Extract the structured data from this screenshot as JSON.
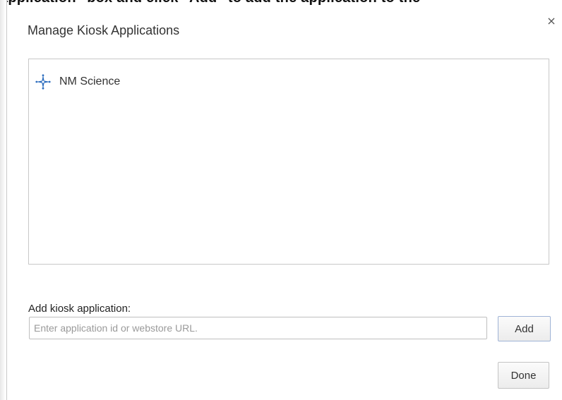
{
  "background": {
    "cut_text": "application\" box and click \"Add\" to add the application to the"
  },
  "dialog": {
    "title": "Manage Kiosk Applications",
    "close_glyph": "×",
    "apps": [
      {
        "name": "NM Science",
        "icon": "blue-four-point-star-icon"
      }
    ],
    "add_label": "Add kiosk application:",
    "add_input": {
      "value": "",
      "placeholder": "Enter application id or webstore URL."
    },
    "add_button_label": "Add",
    "done_button_label": "Done"
  },
  "colors": {
    "icon_blue": "#2f6fbf",
    "text": "#333333",
    "border": "#c8c8c8"
  }
}
